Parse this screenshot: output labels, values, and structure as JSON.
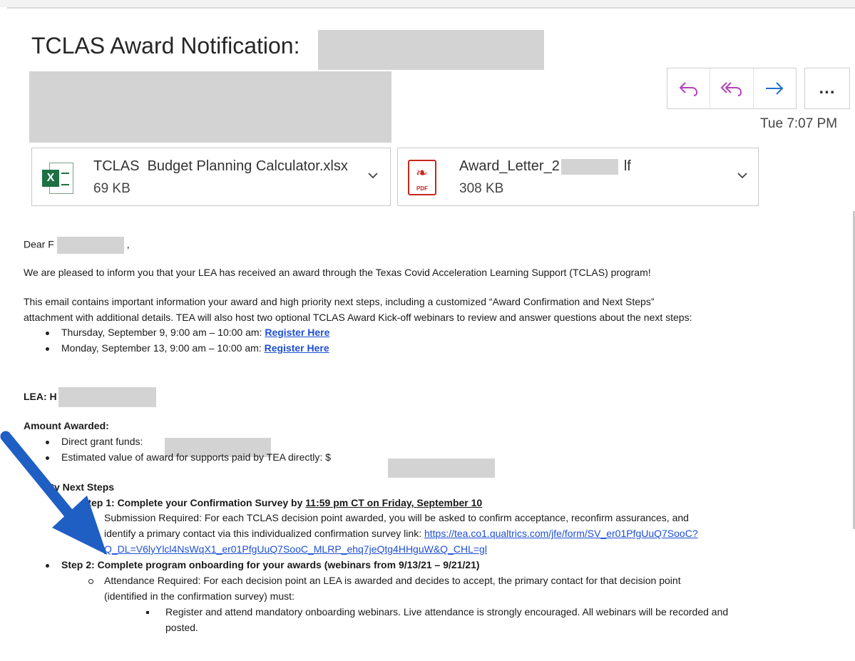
{
  "email": {
    "subject": "TCLAS Award Notification:",
    "time": "Tue 7:07 PM"
  },
  "actions": {
    "reply": "reply-icon",
    "reply_all": "reply-all-icon",
    "forward": "forward-icon",
    "more": "..."
  },
  "attachments": [
    {
      "name": "TCLAS  Budget Planning Calculator.xlsx",
      "size": "69 KB",
      "icon": "excel-icon",
      "badge": "X"
    },
    {
      "name_prefix": "Award_Letter_2",
      "name_suffix": "lf",
      "size": "308 KB",
      "icon": "pdf-icon",
      "badge": "PDF"
    }
  ],
  "body": {
    "greeting_prefix": "Dear F",
    "greeting_suffix": ",",
    "intro": "We are pleased to inform you that your LEA has received an award through the Texas Covid Acceleration Learning Support (TCLAS) program!",
    "para2_line1": "This email contains important information your award and high priority next steps, including a customized “Award Confirmation and Next Steps”",
    "para2_line2": "attachment with additional details. TEA will also host two optional TCLAS Award Kick-off webinars to review and answer questions about the next steps:",
    "webinars": [
      {
        "text": "Thursday, September 9, 9:00 am – 10:00 am: ",
        "link": "Register Here"
      },
      {
        "text": "Monday, September 13, 9:00 am – 10:00 am: ",
        "link": "Register Here"
      }
    ],
    "lea_label": "LEA: H",
    "amount_heading": "Amount Awarded:",
    "amount_items": [
      "Direct grant funds:",
      "Estimated value of award for supports paid by TEA directly: $"
    ],
    "priority_heading": "rity Next Steps",
    "step1": {
      "label": "Step 1: Complete your Confirmation Survey by ",
      "deadline": "11:59 pm CT on Friday, September 10",
      "line1": "Submission Required: For each TCLAS decision point awarded, you will be asked to confirm acceptance, reconfirm assurances, and",
      "line2": "identify a primary contact via this individualized confirmation survey link:  ",
      "link_part1": "https://tea.co1.qualtrics.com/jfe/form/SV_er01PfgUuQ7SooC?",
      "link_part2": "Q_DL=V6lyYlcl4NsWqX1_er01PfgUuQ7SooC_MLRP_ehq7jeQtg4HHguW&Q_CHL=gl"
    },
    "step2": {
      "label": "Step 2: Complete program onboarding for your awards (webinars from 9/13/21 – 9/21/21)",
      "line1": "Attendance Required: For each decision point an LEA is awarded and decides to accept, the primary contact for that decision point",
      "line2": "(identified in the confirmation survey) must:",
      "sub_line1": "Register and attend mandatory onboarding webinars. Live attendance is strongly encouraged. All webinars will be recorded and",
      "sub_line2": "posted."
    }
  },
  "colors": {
    "reply_accent": "#b43fbd",
    "forward_accent": "#1e70c9",
    "link": "#1d4fd6",
    "arrow": "#1f5fc4",
    "redaction": "#d3d3d3"
  }
}
